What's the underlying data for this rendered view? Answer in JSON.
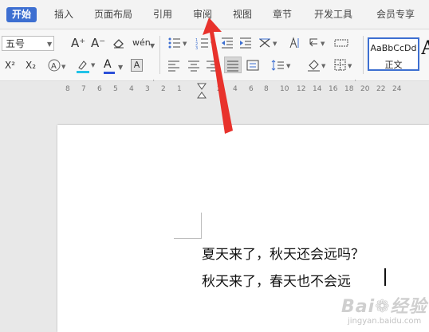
{
  "tabs": [
    {
      "label": "开始",
      "active": true
    },
    {
      "label": "插入"
    },
    {
      "label": "页面布局"
    },
    {
      "label": "引用"
    },
    {
      "label": "审阅"
    },
    {
      "label": "视图"
    },
    {
      "label": "章节"
    },
    {
      "label": "开发工具"
    },
    {
      "label": "会员专享"
    }
  ],
  "ribbon": {
    "font_size_value": "五号",
    "font_grow_icon": "A⁺",
    "font_shrink_icon": "A⁻",
    "clear_format_icon": "eraser-icon",
    "phonetic_icon": "wén",
    "superscript_icon": "X²",
    "subscript_icon": "X₂",
    "highlight_icon": "highlighter-icon",
    "font_color_label": "A",
    "char_shading_label": "A",
    "style_sample": "AaBbCcDd",
    "style_name": "正文",
    "big_style_letter": "A"
  },
  "ruler": {
    "ticks": [
      "8",
      "7",
      "6",
      "5",
      "4",
      "3",
      "2",
      "1",
      "2",
      "4",
      "6",
      "8",
      "10",
      "12",
      "14",
      "16",
      "18",
      "20",
      "22",
      "24"
    ]
  },
  "document": {
    "lines": [
      "夏天来了，秋天还会远吗？",
      "秋天来了，春天也不会远"
    ]
  },
  "watermark": {
    "main": "Bai❁经验",
    "sub": "jingyan.baidu.com"
  },
  "colors": {
    "accent": "#3d6fd1",
    "arrow": "#e8322c",
    "highlight_bar": "#22c3e8",
    "font_color_bar": "#2b4fd8"
  }
}
